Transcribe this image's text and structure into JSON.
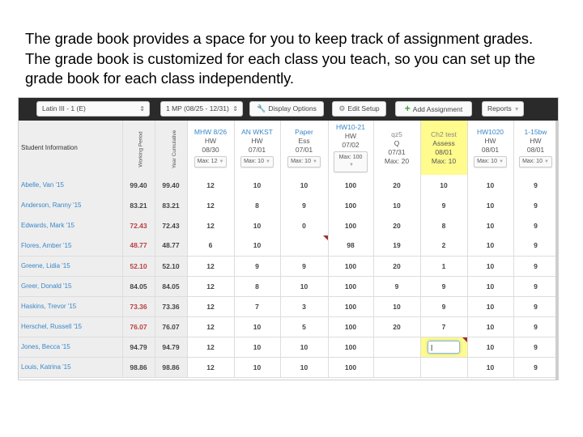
{
  "intro_text": "The grade book provides a space for you to keep track of assignment grades. The grade book is customized for each class you teach, so you can set up the grade book for each class independently.",
  "toolbar": {
    "class_select": "Latin III - 1 (E)",
    "period_select": "1 MP (08/25 - 12/31)",
    "display_options": "Display Options",
    "edit_setup": "Edit Setup",
    "add_assignment": "Add Assignment",
    "reports": "Reports"
  },
  "header": {
    "student_info": "Student Information",
    "working_period": "Working Period",
    "year_cumulative": "Year Cumulative",
    "assignments": [
      {
        "name": "MHW 8/26",
        "type": "HW",
        "date": "08/30",
        "max": "Max: 12",
        "link": true
      },
      {
        "name": "AN WKST",
        "type": "HW",
        "date": "07/01",
        "max": "Max: 10",
        "link": true
      },
      {
        "name": "Paper",
        "type": "Ess",
        "date": "07/01",
        "max": "Max: 10",
        "link": true
      },
      {
        "name": "HW10-21",
        "type": "HW",
        "date": "07/02",
        "max": "Max: 100",
        "link": true
      },
      {
        "name": "qz5",
        "type": "Q",
        "date": "07/31",
        "max": "Max: 20",
        "link": false
      },
      {
        "name": "Ch2 test",
        "type": "Assess",
        "date": "08/01",
        "max": "Max: 10",
        "link": false,
        "highlighted": true
      },
      {
        "name": "HW1020",
        "type": "HW",
        "date": "08/01",
        "max": "Max: 10",
        "link": true
      },
      {
        "name": "1-15bw",
        "type": "HW",
        "date": "08/01",
        "max": "Max: 10",
        "link": true
      }
    ]
  },
  "colors": {
    "link": "#3a87c8",
    "low_grade": "#b94040",
    "highlight": "#fffb8c",
    "toolbar_bg": "#2a2a2a",
    "add_icon": "#3ea33a"
  },
  "students": [
    {
      "name": "Abelle, Van '15",
      "working": "99.40",
      "year": "99.40",
      "low": false,
      "grades": [
        "12",
        "10",
        "10",
        "100",
        "20",
        "10",
        "10",
        "9"
      ]
    },
    {
      "name": "Anderson, Ranny '15",
      "working": "83.21",
      "year": "83.21",
      "low": false,
      "grades": [
        "12",
        "8",
        "9",
        "100",
        "10",
        "9",
        "10",
        "9"
      ]
    },
    {
      "name": "Edwards, Mark '15",
      "working": "72.43",
      "year": "72.43",
      "low": true,
      "grades": [
        "12",
        "10",
        "0",
        "100",
        "20",
        "8",
        "10",
        "9"
      ]
    },
    {
      "name": "Flores, Amber '15",
      "working": "48.77",
      "year": "48.77",
      "low": true,
      "grades": [
        "6",
        "10",
        "",
        "98",
        "19",
        "2",
        "10",
        "9"
      ]
    },
    {
      "name": "Greene, Lidia '15",
      "working": "52.10",
      "year": "52.10",
      "low": true,
      "grades": [
        "12",
        "9",
        "9",
        "100",
        "20",
        "1",
        "10",
        "9"
      ]
    },
    {
      "name": "Greer, Donald '15",
      "working": "84.05",
      "year": "84.05",
      "low": false,
      "grades": [
        "12",
        "8",
        "10",
        "100",
        "9",
        "9",
        "10",
        "9"
      ]
    },
    {
      "name": "Haskins, Trevor '15",
      "working": "73.36",
      "year": "73.36",
      "low": true,
      "grades": [
        "12",
        "7",
        "3",
        "100",
        "10",
        "9",
        "10",
        "9"
      ]
    },
    {
      "name": "Herschel, Russell '15",
      "working": "76.07",
      "year": "76.07",
      "low": true,
      "grades": [
        "12",
        "10",
        "5",
        "100",
        "20",
        "7",
        "10",
        "9"
      ]
    },
    {
      "name": "Jones, Becca '15",
      "working": "94.79",
      "year": "94.79",
      "low": false,
      "selected": true,
      "grades": [
        "12",
        "10",
        "10",
        "100",
        "",
        "",
        "10",
        "9"
      ]
    },
    {
      "name": "Louis, Katrina '15",
      "working": "98.86",
      "year": "98.86",
      "low": false,
      "grades": [
        "12",
        "10",
        "10",
        "100",
        "",
        "",
        "10",
        "9"
      ]
    }
  ]
}
